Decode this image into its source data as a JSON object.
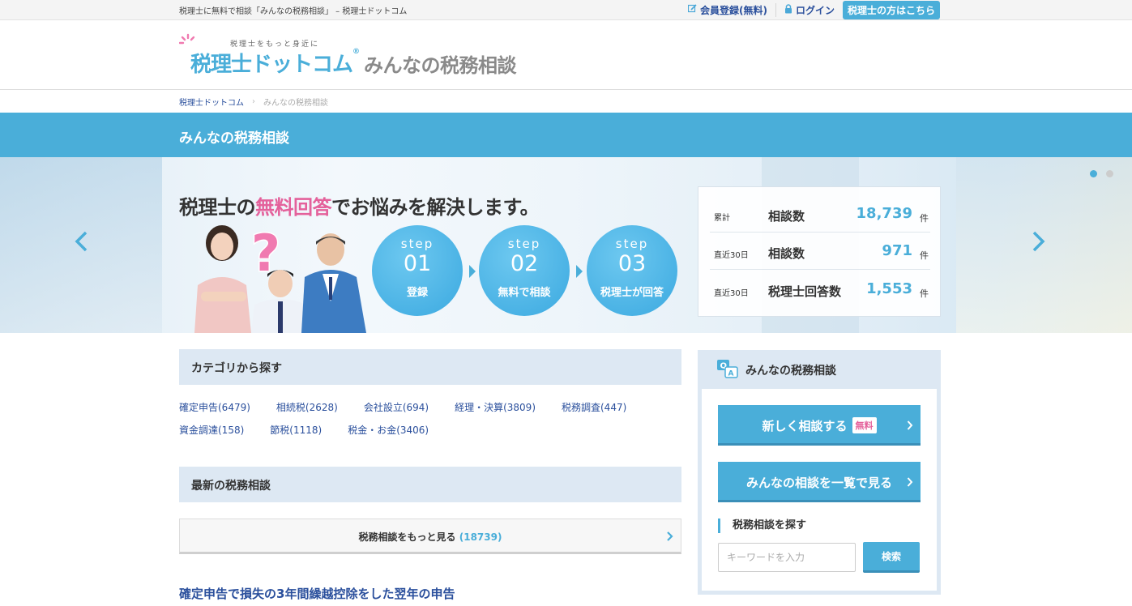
{
  "topbar": {
    "tagline": "税理士に無料で相談「みんなの税務相談」 – 税理士ドットコム",
    "register": "会員登録(無料)",
    "login": "ログイン",
    "for_tax_accountants": "税理士の方はこちら"
  },
  "logo": {
    "sub": "税理士をもっと身近に",
    "brand": "税理士ドットコム",
    "registered": "®",
    "brand2": "みんなの税務相談"
  },
  "breadcrumb": {
    "home": "税理士ドットコム",
    "current": "みんなの税務相談"
  },
  "page_title": "みんなの税務相談",
  "hero": {
    "headline_pre": "税理士の",
    "headline_pink": "無料回答",
    "headline_post": "でお悩みを解決します。",
    "steps": [
      {
        "label": "step",
        "num": "01",
        "desc": "登録"
      },
      {
        "label": "step",
        "num": "02",
        "desc": "無料で相談"
      },
      {
        "label": "step",
        "num": "03",
        "desc": "税理士が回答"
      }
    ],
    "stats": [
      {
        "period": "累計",
        "name": "相談数",
        "value": "18,739",
        "unit": "件"
      },
      {
        "period": "直近30日",
        "name": "相談数",
        "value": "971",
        "unit": "件"
      },
      {
        "period": "直近30日",
        "name": "税理士回答数",
        "value": "1,553",
        "unit": "件"
      }
    ]
  },
  "categories": {
    "heading": "カテゴリから探す",
    "row1": [
      "確定申告(6479)",
      "相続税(2628)",
      "会社設立(694)",
      "経理・決算(3809)",
      "税務調査(447)"
    ],
    "row2": [
      "資金調達(158)",
      "節税(1118)",
      "税金・お金(3406)"
    ]
  },
  "latest": {
    "heading": "最新の税務相談",
    "more_label": "税務相談をもっと見る",
    "more_count": "(18739)",
    "article_title": "確定申告で損失の3年間繰越控除をした翌年の申告"
  },
  "sidebar": {
    "title": "みんなの税務相談",
    "new_consult": "新しく相談する",
    "free_badge": "無料",
    "list_all": "みんなの相談を一覧で見る",
    "search_heading": "税務相談を探す",
    "search_placeholder": "キーワードを入力",
    "search_button": "検索"
  },
  "colors": {
    "accent": "#4aaed9",
    "pink": "#e4619b",
    "link": "#2a4f9c",
    "section_bg": "#dde8f3"
  }
}
